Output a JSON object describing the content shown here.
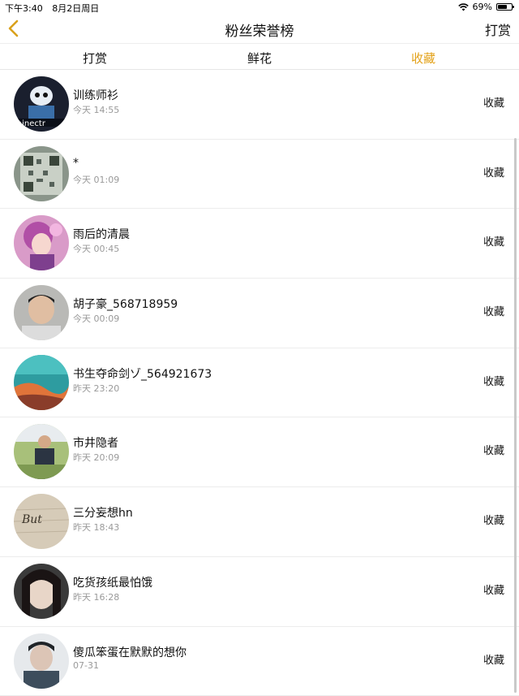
{
  "status_bar": {
    "time": "下午3:40",
    "date": "8月2日周日",
    "battery": "69%",
    "battery_level": 0.69
  },
  "nav": {
    "title": "粉丝荣誉榜",
    "right_action": "打赏",
    "accent_color": "#e3a21a"
  },
  "tabs": [
    {
      "label": "打赏",
      "active": false
    },
    {
      "label": "鲜花",
      "active": false
    },
    {
      "label": "收藏",
      "active": true
    }
  ],
  "list": [
    {
      "name": "训练师衫",
      "time": "今天 14:55",
      "action": "收藏"
    },
    {
      "name": "*",
      "time": "今天 01:09",
      "action": "收藏"
    },
    {
      "name": "雨后的清晨",
      "time": "今天 00:45",
      "action": "收藏"
    },
    {
      "name": "胡子豪_568718959",
      "time": "今天 00:09",
      "action": "收藏"
    },
    {
      "name": "书生夺命剑ゾ_564921673",
      "time": "昨天 23:20",
      "action": "收藏"
    },
    {
      "name": "市井隐者",
      "time": "昨天 20:09",
      "action": "收藏"
    },
    {
      "name": "三分妄想hn",
      "time": "昨天 18:43",
      "action": "收藏"
    },
    {
      "name": "吃货孩纸最怕饿",
      "time": "昨天 16:28",
      "action": "收藏"
    },
    {
      "name": "傻瓜笨蛋在默默的想你",
      "time": "07-31",
      "action": "收藏"
    }
  ]
}
